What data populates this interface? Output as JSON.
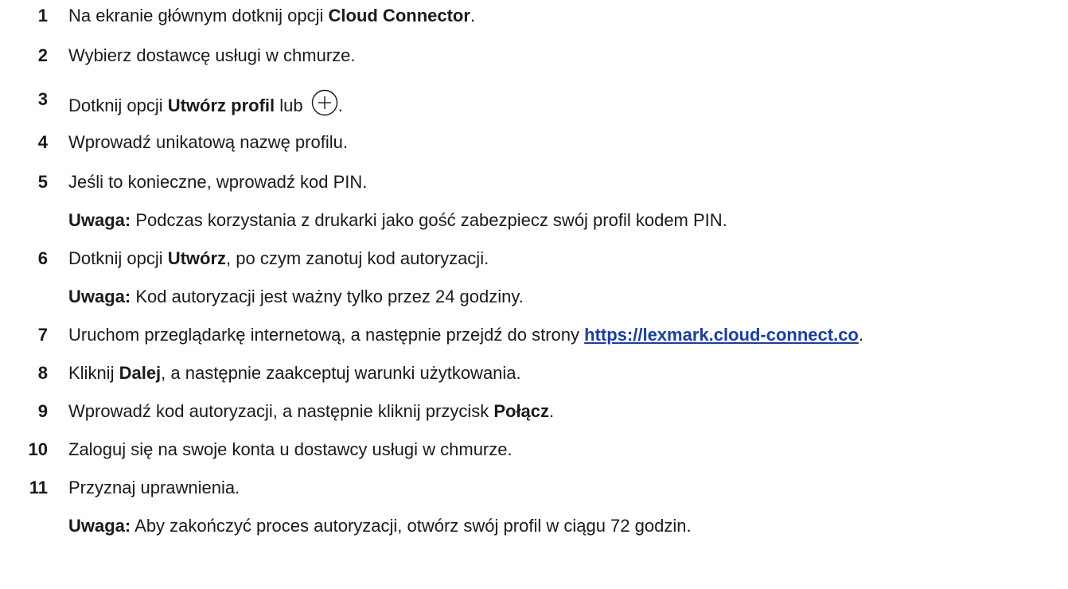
{
  "steps": [
    {
      "num": "1",
      "a": "Na ekranie głównym dotknij opcji ",
      "b": "Cloud Connector",
      "c": "."
    },
    {
      "num": "2",
      "a": "Wybierz dostawcę usługi w chmurze."
    },
    {
      "num": "3",
      "a": "Dotknij opcji ",
      "b": "Utwórz profil",
      "c": " lub ",
      "d": "."
    },
    {
      "num": "4",
      "a": "Wprowadź unikatową nazwę profilu."
    },
    {
      "num": "5",
      "a": "Jeśli to konieczne, wprowadź kod PIN."
    },
    {
      "num": "6",
      "a": "Dotknij opcji ",
      "b": "Utwórz",
      "c": ", po czym zanotuj kod autoryzacji."
    },
    {
      "num": "7",
      "a": "Uruchom przeglądarkę internetową, a następnie przejdź do strony ",
      "link": "https://lexmark.cloud-connect.co",
      "c": "."
    },
    {
      "num": "8",
      "a": "Kliknij ",
      "b": "Dalej",
      "c": ", a następnie zaakceptuj warunki użytkowania."
    },
    {
      "num": "9",
      "a": "Wprowadź kod autoryzacji, a następnie kliknij przycisk ",
      "b": "Połącz",
      "c": "."
    },
    {
      "num": "10",
      "a": "Zaloguj się na swoje konta u dostawcy usługi w chmurze."
    },
    {
      "num": "11",
      "a": "Przyznaj uprawnienia."
    }
  ],
  "notes": {
    "label": "Uwaga:",
    "n5": " Podczas korzystania z drukarki jako gość zabezpiecz swój profil kodem PIN.",
    "n6": " Kod autoryzacji jest ważny tylko przez 24 godziny.",
    "n11": " Aby zakończyć proces autoryzacji, otwórz swój profil w ciągu 72 godzin."
  },
  "icons": {
    "step3": "plus-circle-icon"
  }
}
